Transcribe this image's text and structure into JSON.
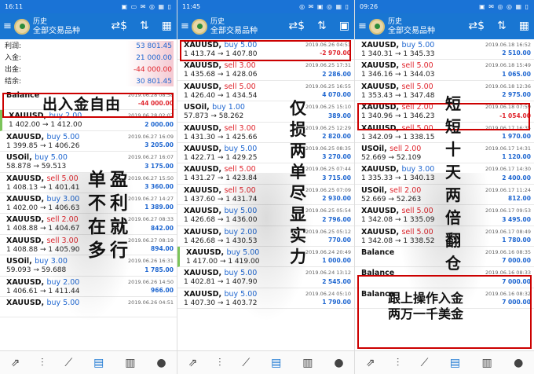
{
  "app": {
    "history_label": "历史",
    "subtitle": "全部交易品种",
    "menu_icon": "menu-icon",
    "sort_icon": "sort-icon",
    "calendar_icon": "calendar-icon"
  },
  "nav_icons": [
    "trade-icon",
    "quotes-icon",
    "chart-icon",
    "history-inbox-icon",
    "news-icon",
    "chat-icon"
  ],
  "screens": [
    {
      "status": {
        "time": "16:11",
        "icons": "▣ ▭ ✉  ◎ ▦ ▯"
      },
      "summary": [
        {
          "label": "利润:",
          "value": "53 801.45",
          "neg": false
        },
        {
          "label": "入金:",
          "value": "21 000.00",
          "neg": false
        },
        {
          "label": "出金:",
          "value": "-44 000.00",
          "neg": true
        },
        {
          "label": "结余:",
          "value": "30 801.45",
          "neg": false
        }
      ],
      "rows": [
        {
          "sym": "Balance",
          "type": "",
          "dir": "",
          "prices": "",
          "date": "2019.06.28 08:58",
          "profit": "-44 000.00",
          "neg": true
        },
        {
          "sym": "XAUUSD,",
          "type": "buy 2.00",
          "dir": "buy",
          "prices": "1 402.00 → 1 412.00",
          "date": "2019.06.28 02:07",
          "profit": "2 000.00",
          "neg": false,
          "accent": true
        },
        {
          "sym": "XAUUSD,",
          "type": "buy 5.00",
          "dir": "buy",
          "prices": "1 399.85 → 1 406.26",
          "date": "2019.06.27 16:09",
          "profit": "3 205.00",
          "neg": false
        },
        {
          "sym": "USOil,",
          "type": "buy 5.00",
          "dir": "buy",
          "prices": "58.878 → 59.513",
          "date": "2019.06.27 16:07",
          "profit": "3 175.00",
          "neg": false
        },
        {
          "sym": "XAUUSD,",
          "type": "sell 5.00",
          "dir": "sell",
          "prices": "1 408.13 → 1 401.41",
          "date": "2019.06.27 15:50",
          "profit": "3 360.00",
          "neg": false
        },
        {
          "sym": "XAUUSD,",
          "type": "buy 3.00",
          "dir": "buy",
          "prices": "1 402.00 → 1 406.63",
          "date": "2019.06.27 14:27",
          "profit": "1 389.00",
          "neg": false
        },
        {
          "sym": "XAUUSD,",
          "type": "sell 2.00",
          "dir": "sell",
          "prices": "1 408.88 → 1 404.67",
          "date": "2019.06.27 08:33",
          "profit": "842.00",
          "neg": false
        },
        {
          "sym": "XAUUSD,",
          "type": "sell 3.00",
          "dir": "sell",
          "prices": "1 408.88 → 1 405.90",
          "date": "2019.06.27 08:19",
          "profit": "894.00",
          "neg": false
        },
        {
          "sym": "USOil,",
          "type": "buy 3.00",
          "dir": "buy",
          "prices": "59.093 → 59.688",
          "date": "2019.06.26 16:31",
          "profit": "1 785.00",
          "neg": false
        },
        {
          "sym": "XAUUSD,",
          "type": "buy 2.00",
          "dir": "buy",
          "prices": "1 406.61 → 1 411.44",
          "date": "2019.06.26 14:50",
          "profit": "966.00",
          "neg": false
        },
        {
          "sym": "XAUUSD,",
          "type": "buy 5.00",
          "dir": "buy",
          "prices": "",
          "date": "2019.06.26 04:51",
          "profit": "",
          "neg": false
        }
      ],
      "callouts": {
        "top": "出入金自由",
        "body_left": [
          "单",
          "不",
          "在",
          "多"
        ],
        "body_right": [
          "盈",
          "利",
          "就",
          "行"
        ]
      }
    },
    {
      "status": {
        "time": "11:45",
        "icons": "◎ ✉ ▣  ◎ ▦ ▯"
      },
      "rows": [
        {
          "sym": "XAUUSD,",
          "type": "buy 5.00",
          "dir": "buy",
          "prices": "1 413.74 → 1 407.80",
          "date": "2019.06.26 04:51",
          "profit": "-2 970.00",
          "neg": true
        },
        {
          "sym": "XAUUSD,",
          "type": "sell 3.00",
          "dir": "sell",
          "prices": "1 435.68 → 1 428.06",
          "date": "2019.06.25 17:31",
          "profit": "2 286.00",
          "neg": false
        },
        {
          "sym": "XAUUSD,",
          "type": "sell 5.00",
          "dir": "sell",
          "prices": "1 426.40 → 1 434.54",
          "date": "2019.06.25 16:55",
          "profit": "4 070.00",
          "neg": false
        },
        {
          "sym": "USOil,",
          "type": "buy 1.00",
          "dir": "buy",
          "prices": "57.873 → 58.262",
          "date": "2019.06.25 15:10",
          "profit": "389.00",
          "neg": false
        },
        {
          "sym": "XAUUSD,",
          "type": "sell 3.00",
          "dir": "sell",
          "prices": "1 431.30 → 1 425.66",
          "date": "2019.06.25 12:29",
          "profit": "2 820.00",
          "neg": false
        },
        {
          "sym": "XAUUSD,",
          "type": "buy 5.00",
          "dir": "buy",
          "prices": "1 422.71 → 1 429.25",
          "date": "2019.06.25 08:35",
          "profit": "3 270.00",
          "neg": false
        },
        {
          "sym": "XAUUSD,",
          "type": "sell 5.00",
          "dir": "sell",
          "prices": "1 431.27 → 1 423.84",
          "date": "2019.06.25 07:44",
          "profit": "3 715.00",
          "neg": false
        },
        {
          "sym": "XAUUSD,",
          "type": "sell 5.00",
          "dir": "sell",
          "prices": "1 437.60 → 1 431.74",
          "date": "2019.06.25 07:09",
          "profit": "2 930.00",
          "neg": false
        },
        {
          "sym": "XAUUSD,",
          "type": "buy 5.00",
          "dir": "buy",
          "prices": "1 426.68 → 1 436.00",
          "date": "2019.06.25 05:54",
          "profit": "2 796.00",
          "neg": false
        },
        {
          "sym": "XAUUSD,",
          "type": "buy 2.00",
          "dir": "buy",
          "prices": "1 426.68 → 1 430.53",
          "date": "2019.06.25 05:12",
          "profit": "770.00",
          "neg": false
        },
        {
          "sym": "XAUUSD,",
          "type": "buy 5.00",
          "dir": "buy",
          "prices": "1 417.00 → 1 419.00",
          "date": "2019.06.24 20:49",
          "profit": "1 000.00",
          "neg": false,
          "accent": true
        },
        {
          "sym": "XAUUSD,",
          "type": "buy 5.00",
          "dir": "buy",
          "prices": "1 402.81 → 1 407.90",
          "date": "2019.06.24 13:12",
          "profit": "2 545.00",
          "neg": false
        },
        {
          "sym": "XAUUSD,",
          "type": "buy 5.00",
          "dir": "buy",
          "prices": "1 407.30 → 1 403.72",
          "date": "2019.06.24 05:10",
          "profit": "1 790.00",
          "neg": false
        }
      ],
      "callouts": {
        "col1": [
          "仅",
          "损",
          "两",
          "单"
        ],
        "col2": [
          "尽",
          "显",
          "实",
          "力"
        ]
      }
    },
    {
      "status": {
        "time": "09:26",
        "icons": "▣ ✉ ◎  ◎ ▦ ▯"
      },
      "rows": [
        {
          "sym": "XAUUSD,",
          "type": "buy 5.00",
          "dir": "buy",
          "prices": "1 340.31 → 1 345.33",
          "date": "2019.06.18 16:52",
          "profit": "2 510.00",
          "neg": false
        },
        {
          "sym": "XAUUSD,",
          "type": "sell 5.00",
          "dir": "sell",
          "prices": "1 346.16 → 1 344.03",
          "date": "2019.06.18 15:49",
          "profit": "1 065.00",
          "neg": false
        },
        {
          "sym": "XAUUSD,",
          "type": "sell 5.00",
          "dir": "sell",
          "prices": "1 353.43 → 1 347.48",
          "date": "2019.06.18 12:36",
          "profit": "2 975.00",
          "neg": false
        },
        {
          "sym": "XAUUSD,",
          "type": "sell 2.00",
          "dir": "sell",
          "prices": "1 340.96 → 1 346.23",
          "date": "2019.06.18 07:59",
          "profit": "-1 054.00",
          "neg": true
        },
        {
          "sym": "XAUUSD,",
          "type": "sell 5.00",
          "dir": "sell",
          "prices": "1 342.09 → 1 338.15",
          "date": "2019.06.17 16:35",
          "profit": "1 970.00",
          "neg": false
        },
        {
          "sym": "USOil,",
          "type": "sell 2.00",
          "dir": "sell",
          "prices": "52.669 → 52.109",
          "date": "2019.06.17 14:31",
          "profit": "1 120.00",
          "neg": false
        },
        {
          "sym": "XAUUSD,",
          "type": "buy 3.00",
          "dir": "buy",
          "prices": "1 335.33 → 1 340.13",
          "date": "2019.06.17 14:30",
          "profit": "2 400.00",
          "neg": false
        },
        {
          "sym": "USOil,",
          "type": "sell 2.00",
          "dir": "sell",
          "prices": "52.669 → 52.263",
          "date": "2019.06.17 11:24",
          "profit": "812.00",
          "neg": false
        },
        {
          "sym": "XAUUSD,",
          "type": "sell 5.00",
          "dir": "sell",
          "prices": "1 342.08 → 1 335.09",
          "date": "2019.06.17 09:53",
          "profit": "3 495.00",
          "neg": false
        },
        {
          "sym": "XAUUSD,",
          "type": "sell 5.00",
          "dir": "sell",
          "prices": "1 342.08 → 1 338.52",
          "date": "2019.06.17 08:49",
          "profit": "1 780.00",
          "neg": false
        },
        {
          "sym": "Balance",
          "type": "",
          "dir": "",
          "prices": "",
          "date": "2019.06.16 08:35",
          "profit": "7 000.00",
          "neg": false
        },
        {
          "sym": "Balance",
          "type": "",
          "dir": "",
          "prices": "",
          "date": "2019.06.16 08:33",
          "profit": "7 000.00",
          "neg": false
        },
        {
          "sym": "Balance",
          "type": "",
          "dir": "",
          "prices": "",
          "date": "2019.06.16 08:32",
          "profit": "7 000.00",
          "neg": false
        }
      ],
      "callouts": {
        "col": [
          "短",
          "短",
          "十",
          "天",
          "两",
          "倍",
          "翻",
          "仓"
        ],
        "bottom_l1": "跟上操作入金",
        "bottom_l2": "两万一千美金"
      }
    }
  ]
}
